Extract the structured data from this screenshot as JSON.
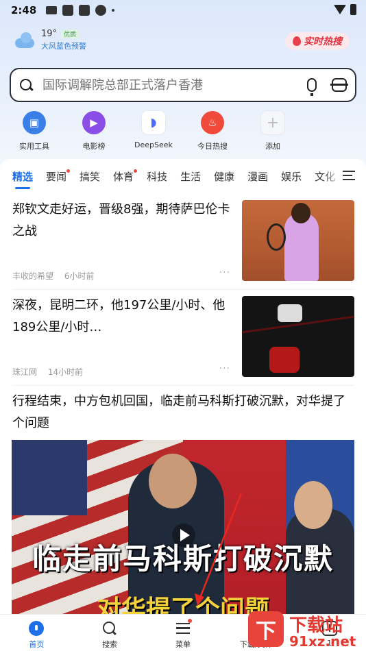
{
  "status_bar": {
    "time": "2:48"
  },
  "weather": {
    "temperature": "19°",
    "air_quality": "优质",
    "warning": "大风蓝色预警"
  },
  "hot_search_button": {
    "label": "实时热搜"
  },
  "search": {
    "placeholder": "国际调解院总部正式落户香港"
  },
  "shortcuts": [
    {
      "label": "实用工具",
      "icon": "toolbox-icon"
    },
    {
      "label": "电影榜",
      "icon": "movie-icon"
    },
    {
      "label": "DeepSeek",
      "icon": "deepseek-whale-icon"
    },
    {
      "label": "今日热搜",
      "icon": "flame-icon"
    },
    {
      "label": "添加",
      "icon": "plus-icon"
    }
  ],
  "tabs": [
    {
      "label": "精选",
      "active": true,
      "dot": false
    },
    {
      "label": "要闻",
      "active": false,
      "dot": true
    },
    {
      "label": "搞笑",
      "active": false,
      "dot": false
    },
    {
      "label": "体育",
      "active": false,
      "dot": true
    },
    {
      "label": "科技",
      "active": false,
      "dot": false
    },
    {
      "label": "生活",
      "active": false,
      "dot": false
    },
    {
      "label": "健康",
      "active": false,
      "dot": false
    },
    {
      "label": "漫画",
      "active": false,
      "dot": false
    },
    {
      "label": "娱乐",
      "active": false,
      "dot": false
    },
    {
      "label": "文化",
      "active": false,
      "dot": false
    }
  ],
  "news": [
    {
      "title": "郑钦文走好运，晋级8强，期待萨巴伦卡之战",
      "source": "丰收的希望",
      "time": "6小时前"
    },
    {
      "title": "深夜，昆明二环，他197公里/小时、他189公里/小时…",
      "source": "珠江网",
      "time": "14小时前"
    },
    {
      "title": "行程结束，中方包机回国，临走前马科斯打破沉默，对华提了个问题",
      "caption_line1": "临走前马科斯打破沉默",
      "caption_line2": "对华提了个问题"
    }
  ],
  "bottom_nav": [
    {
      "label": "首页",
      "icon": "home-icon",
      "active": true
    },
    {
      "label": "搜索",
      "icon": "search-icon"
    },
    {
      "label": "菜单",
      "icon": "menu-icon",
      "dot": true
    },
    {
      "label": "下载/文件",
      "icon": "download-icon"
    },
    {
      "label": "1",
      "icon": "tabs-icon"
    }
  ],
  "watermark": {
    "logo_text": "下",
    "line1": "下载站",
    "line2": "91xz.net"
  },
  "colors": {
    "accent": "#1e6fe8",
    "hot_red": "#e23340",
    "badge_dot": "#ee4a3c"
  }
}
